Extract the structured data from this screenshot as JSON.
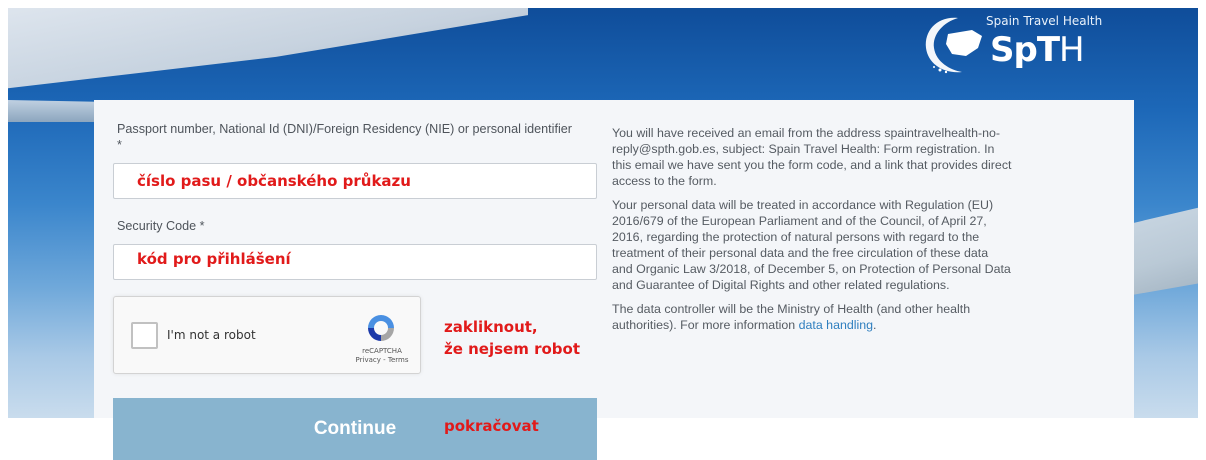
{
  "logo": {
    "tagline": "Spain Travel Health",
    "abbr_bold": "SpT",
    "abbr_thin": "H"
  },
  "form": {
    "passport_label": "Passport number, National Id (DNI)/Foreign Residency (NIE) or personal identifier *",
    "passport_value": "",
    "security_label": "Security Code *",
    "security_value": "",
    "captcha": {
      "label": "I'm not a robot",
      "brand": "reCAPTCHA",
      "links": "Privacy - Terms"
    },
    "continue_label": "Continue"
  },
  "info": {
    "paragraph_1": "You will have received an email from the address spaintravelhealth-no-reply@spth.gob.es, subject: Spain Travel Health: Form registration. In this email we have sent you the form code, and a link that provides direct access to the form.",
    "paragraph_2": "Your personal data will be treated in accordance with Regulation (EU) 2016/679 of the European Parliament and of the Council, of April 27, 2016, regarding the protection of natural persons with regard to the treatment of their personal data and the free circulation of these data and Organic Law 3/2018, of December 5, on Protection of Personal Data and Guarantee of Digital Rights and other related regulations.",
    "paragraph_3_text": "The data controller will be the Ministry of Health (and other health authorities). For more information ",
    "paragraph_3_link": "data handling",
    "paragraph_3_end": "."
  },
  "annotations": {
    "passport_note": "číslo pasu / občanského průkazu",
    "security_note": "kód pro přihlášení",
    "captcha_note_line1": "zakliknout,",
    "captcha_note_line2": "že nejsem robot",
    "continue_note": "pokračovat"
  },
  "colors": {
    "accent": "#88b4cf",
    "annotation": "#e11a1a",
    "link": "#2f7fbf"
  }
}
